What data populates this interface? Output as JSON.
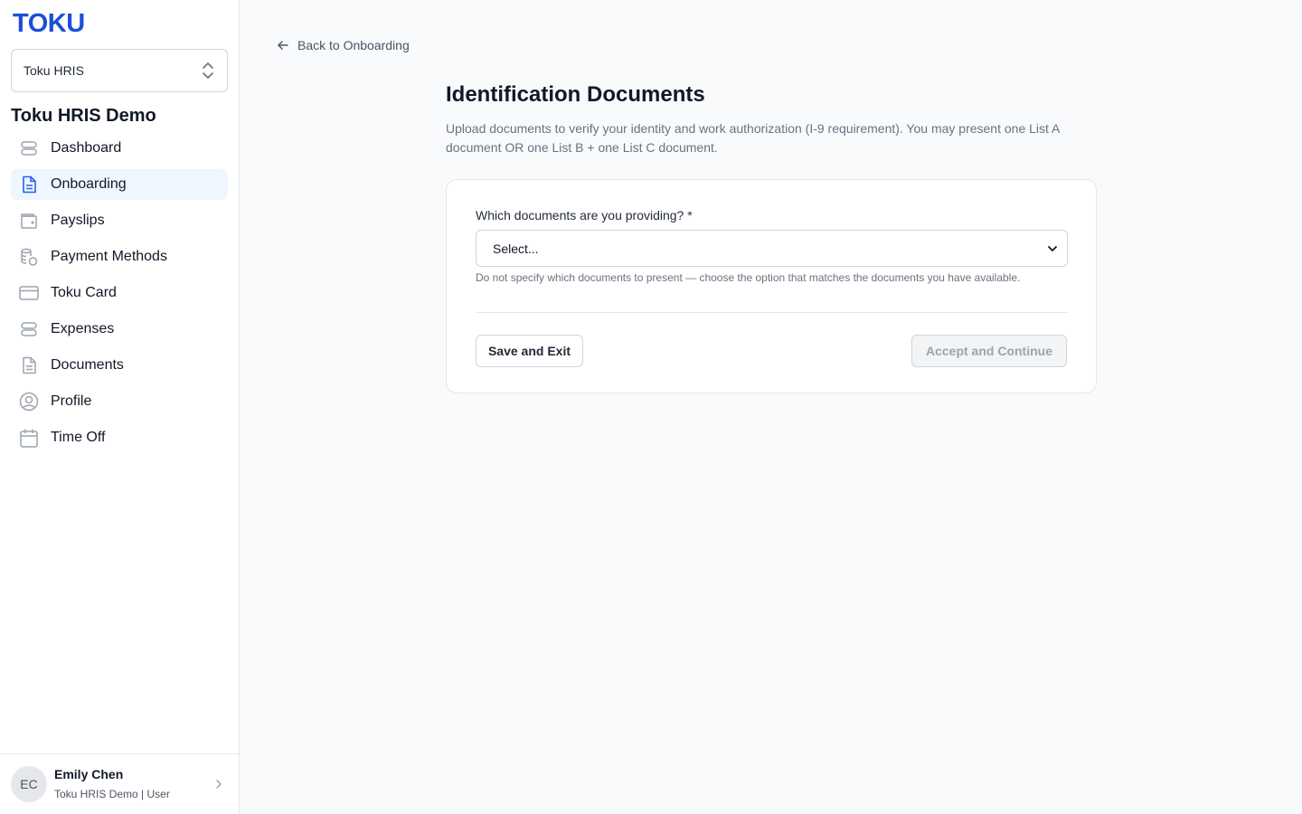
{
  "brand": {
    "logo_text": "TOKU",
    "accent": "#1d4ed8"
  },
  "sidebar": {
    "org_select": {
      "value": "Toku HRIS",
      "icon": "chevron-up-down-icon"
    },
    "org_title": "Toku HRIS Demo",
    "items": [
      {
        "label": "Dashboard",
        "icon": "stack-icon",
        "active": false
      },
      {
        "label": "Onboarding",
        "icon": "document-text-icon",
        "active": true
      },
      {
        "label": "Payslips",
        "icon": "wallet-icon",
        "active": false
      },
      {
        "label": "Payment Methods",
        "icon": "coins-icon",
        "active": false
      },
      {
        "label": "Toku Card",
        "icon": "credit-card-icon",
        "active": false
      },
      {
        "label": "Expenses",
        "icon": "stack-icon",
        "active": false
      },
      {
        "label": "Documents",
        "icon": "document-icon",
        "active": false
      },
      {
        "label": "Profile",
        "icon": "user-circle-icon",
        "active": false
      },
      {
        "label": "Time Off",
        "icon": "calendar-icon",
        "active": false
      }
    ],
    "user": {
      "initials": "EC",
      "name": "Emily Chen",
      "subtitle": "Toku HRIS Demo | User"
    }
  },
  "main": {
    "back_link": "Back to Onboarding",
    "title": "Identification Documents",
    "description": "Upload documents to verify your identity and work authorization (I-9 requirement). You may present one List A document OR one List B + one List C document.",
    "form": {
      "field_label": "Which documents are you providing? *",
      "select_value": "Select...",
      "help_text": "Do not specify which documents to present — choose the option that matches the documents you have available.",
      "save_button": "Save and Exit",
      "continue_button": "Accept and Continue",
      "continue_disabled": true
    }
  }
}
